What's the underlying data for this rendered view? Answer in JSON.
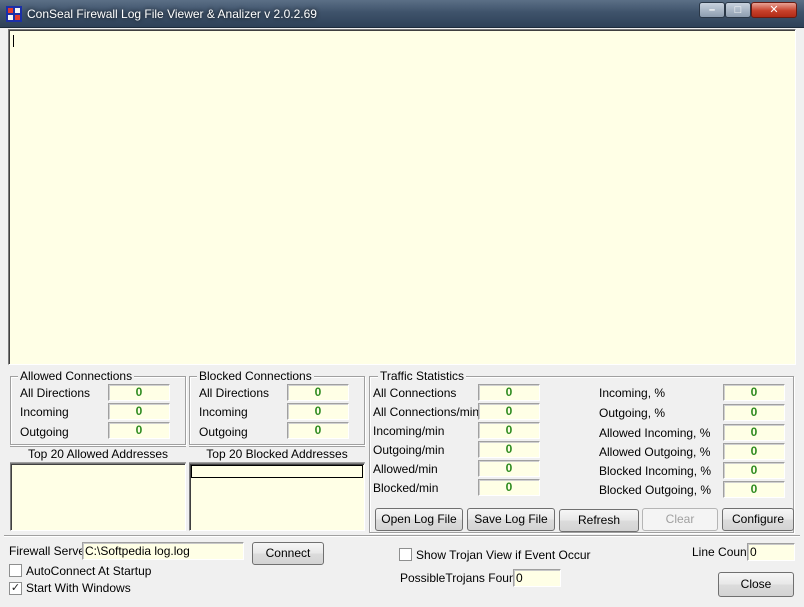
{
  "window": {
    "title": "ConSeal Firewall Log File Viewer & Analizer v 2.0.2.69",
    "minimize_glyph": "–",
    "maximize_glyph": "□",
    "close_glyph": "✕"
  },
  "allowed": {
    "title": "Allowed Connections",
    "rows": [
      {
        "label": "All Directions",
        "value": "0"
      },
      {
        "label": "Incoming",
        "value": "0"
      },
      {
        "label": "Outgoing",
        "value": "0"
      }
    ],
    "top20_label": "Top 20 Allowed Addresses"
  },
  "blocked": {
    "title": "Blocked Connections",
    "rows": [
      {
        "label": "All Directions",
        "value": "0"
      },
      {
        "label": "Incoming",
        "value": "0"
      },
      {
        "label": "Outgoing",
        "value": "0"
      }
    ],
    "top20_label": "Top 20 Blocked Addresses"
  },
  "traffic": {
    "title": "Traffic Statistics",
    "left": [
      {
        "label": "All Connections",
        "value": "0"
      },
      {
        "label": "All Connections/min",
        "value": "0"
      },
      {
        "label": "Incoming/min",
        "value": "0"
      },
      {
        "label": "Outgoing/min",
        "value": "0"
      },
      {
        "label": "Allowed/min",
        "value": "0"
      },
      {
        "label": "Blocked/min",
        "value": "0"
      }
    ],
    "right": [
      {
        "label": "Incoming, %",
        "value": "0"
      },
      {
        "label": "Outgoing, %",
        "value": "0"
      },
      {
        "label": "Allowed Incoming, %",
        "value": "0"
      },
      {
        "label": "Allowed Outgoing, %",
        "value": "0"
      },
      {
        "label": "Blocked Incoming, %",
        "value": "0"
      },
      {
        "label": "Blocked Outgoing, %",
        "value": "0"
      }
    ]
  },
  "buttons": {
    "open_log": "Open Log File",
    "save_log": "Save Log File",
    "refresh": "Refresh",
    "clear": "Clear",
    "configure": "Configure",
    "connect": "Connect",
    "close": "Close"
  },
  "bottom": {
    "firewall_server_label": "Firewall Server",
    "firewall_server_value": "C:\\Softpedia log.log",
    "autoconnect_label": "AutoConnect At Startup",
    "autoconnect_checked": false,
    "start_windows_label": "Start With Windows",
    "start_windows_checked": true,
    "show_trojan_label": "Show Trojan View if Event Occur",
    "show_trojan_checked": false,
    "possible_trojans_label": "PossibleTrojans Found",
    "possible_trojans_value": "0",
    "line_count_label": "Line Count",
    "line_count_value": "0",
    "check_mark": "✓"
  },
  "colors": {
    "panel_bg": "#ffffe6",
    "counter_green": "#2e8b1f",
    "titlebar": "#3f536b"
  }
}
